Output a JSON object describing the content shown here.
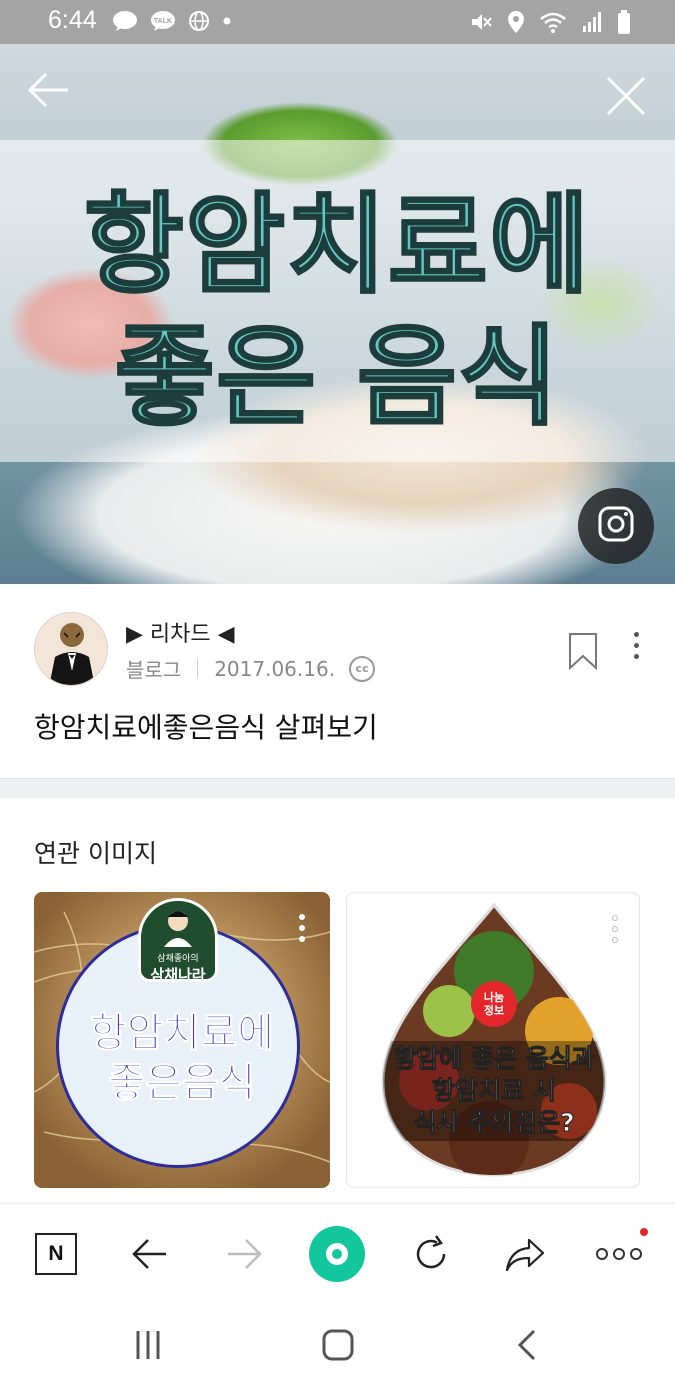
{
  "status_bar": {
    "time": "6:44",
    "left_icons": [
      "chat-bubble-icon",
      "talk-icon",
      "globe-icon",
      "dot-icon"
    ],
    "right_icons": [
      "mute-icon",
      "location-icon",
      "wifi-icon",
      "signal-icon",
      "battery-icon"
    ],
    "talk_label": "TALK"
  },
  "hero": {
    "title_line1": "항암치료에",
    "title_line2": "좋은 음식",
    "back_icon": "arrow-left-icon",
    "close_icon": "close-icon",
    "lens_icon": "image-search-icon"
  },
  "author": {
    "name": "▶ 리차드 ◀",
    "source": "블로그",
    "date": "2017.06.16.",
    "license_badge": "cc",
    "post_title": "항암치료에좋은음식 살펴보기"
  },
  "related": {
    "section_title": "연관 이미지",
    "cards": [
      {
        "badge_small": "삼채좋아의",
        "badge_name": "삼채나라",
        "text_line1": "항암치료에",
        "text_line2": "좋은음식"
      },
      {
        "badge": "나눔\n정보",
        "text_line1": "항암에 좋은 음식과",
        "text_line2": "항암치료 시",
        "text_line3": "식사 주의점은?"
      }
    ]
  },
  "toolbar": {
    "home_label": "N",
    "buttons": [
      "naver-home-icon",
      "back-arrow-icon",
      "forward-arrow-icon",
      "green-dot-button",
      "refresh-icon",
      "share-icon",
      "more-icon"
    ]
  },
  "colors": {
    "status_bar": "#a4a4a4",
    "hero_text": "#63c7c0",
    "green_button": "#12c79e",
    "notification_dot": "#e3262a",
    "card1_text": "#3a2fd6"
  }
}
